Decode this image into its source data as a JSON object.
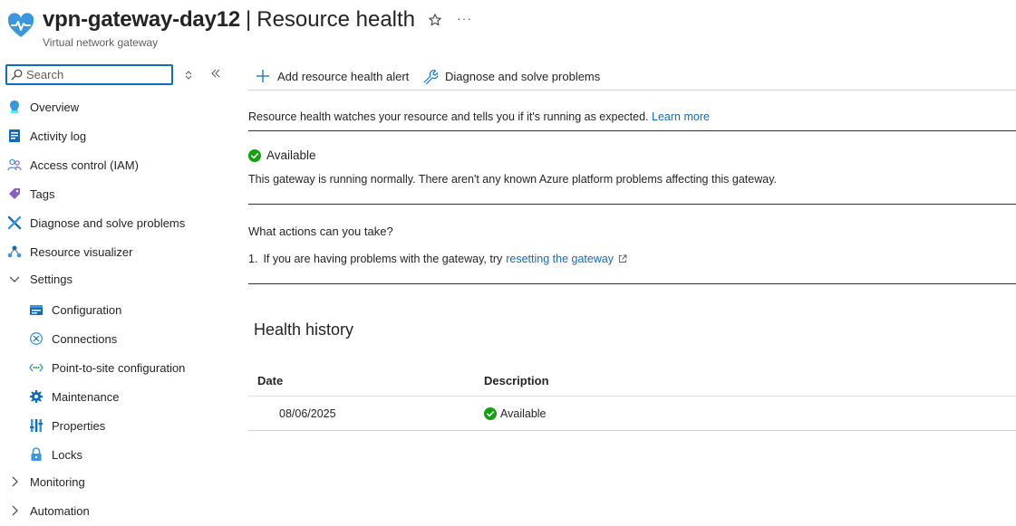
{
  "header": {
    "resource_name": "vpn-gateway-day12",
    "separator": "|",
    "page_title": "Resource health",
    "more_label": "···",
    "subtitle": "Virtual network gateway"
  },
  "search": {
    "placeholder": "Search",
    "value": ""
  },
  "sidebar": {
    "items": [
      {
        "label": "Overview",
        "icon": "overview-icon"
      },
      {
        "label": "Activity log",
        "icon": "activity-log-icon"
      },
      {
        "label": "Access control (IAM)",
        "icon": "people-icon"
      },
      {
        "label": "Tags",
        "icon": "tag-icon"
      },
      {
        "label": "Diagnose and solve problems",
        "icon": "wrench-icon"
      },
      {
        "label": "Resource visualizer",
        "icon": "visualizer-icon"
      },
      {
        "label": "Settings",
        "icon": "chevron-down-icon"
      },
      {
        "label": "Configuration",
        "icon": "configuration-icon"
      },
      {
        "label": "Connections",
        "icon": "connections-icon"
      },
      {
        "label": "Point-to-site configuration",
        "icon": "point-to-site-icon"
      },
      {
        "label": "Maintenance",
        "icon": "gear-icon"
      },
      {
        "label": "Properties",
        "icon": "properties-icon"
      },
      {
        "label": "Locks",
        "icon": "lock-icon"
      },
      {
        "label": "Monitoring",
        "icon": "chevron-right-icon"
      },
      {
        "label": "Automation",
        "icon": "chevron-right-icon"
      }
    ]
  },
  "toolbar": {
    "add_alert_label": "Add resource health alert",
    "diagnose_label": "Diagnose and solve problems"
  },
  "main": {
    "info_text": "Resource health watches your resource and tells you if it's running as expected.",
    "learn_more": "Learn more",
    "status_label": "Available",
    "status_description": "This gateway is running normally. There aren't any known Azure platform problems affecting this gateway.",
    "actions_title": "What actions can you take?",
    "action_number": "1.",
    "action_text": "If you are having problems with the gateway, try",
    "action_link": "resetting the gateway"
  },
  "history": {
    "title": "Health history",
    "columns": [
      "Date",
      "Description"
    ],
    "rows": [
      {
        "date": "08/06/2025",
        "description": "Available"
      }
    ]
  },
  "colors": {
    "accent": "#0f6cbd",
    "success": "#13a10e",
    "text": "#242424"
  }
}
